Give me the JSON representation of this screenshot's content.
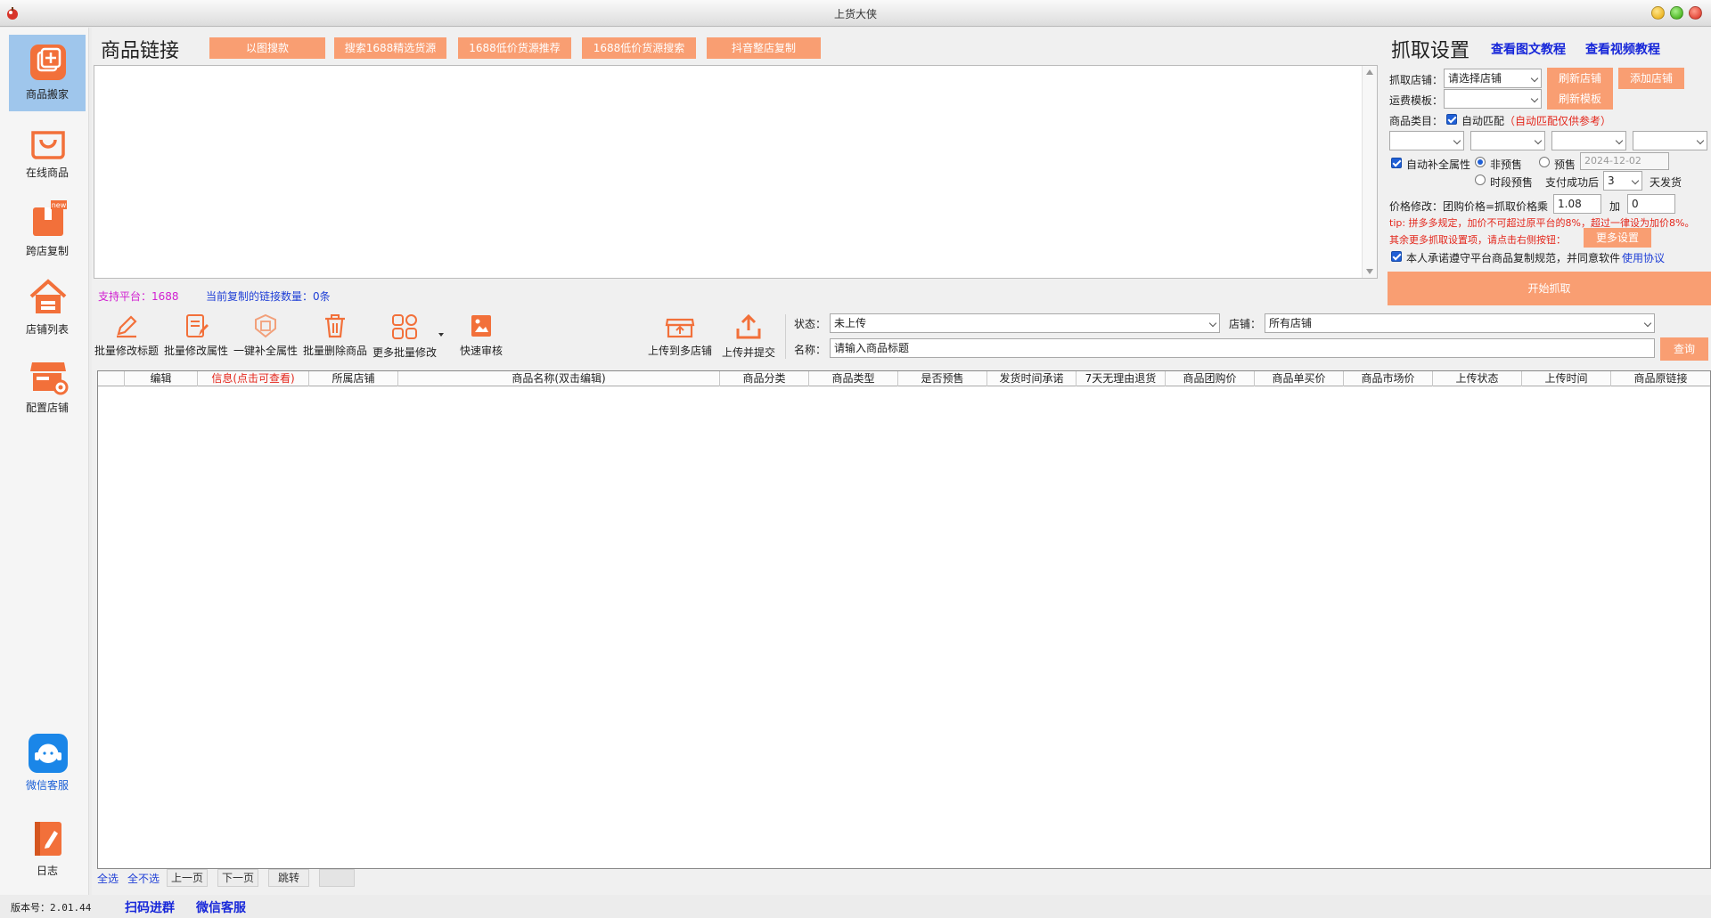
{
  "window": {
    "title": "上货大侠"
  },
  "sidebar": {
    "items": [
      {
        "label": "商品搬家"
      },
      {
        "label": "在线商品"
      },
      {
        "label": "跨店复制",
        "badge": "new"
      },
      {
        "label": "店铺列表"
      },
      {
        "label": "配置店铺"
      },
      {
        "label": "微信客服"
      },
      {
        "label": "日志"
      }
    ]
  },
  "links_section": {
    "title": "商品链接",
    "buttons": [
      "以图搜款",
      "搜索1688精选货源",
      "1688低价货源推荐",
      "1688低价货源搜索",
      "抖音整店复制"
    ],
    "support_platform": "支持平台：1688",
    "copied_count": "当前复制的链接数量：0条"
  },
  "toolbar": {
    "items": [
      "批量修改标题",
      "批量修改属性",
      "一键补全属性",
      "批量删除商品",
      "更多批量修改",
      "快速审核",
      "上传到多店铺",
      "上传并提交"
    ]
  },
  "filters": {
    "status_label": "状态：",
    "status_value": "未上传",
    "shop_label": "店铺：",
    "shop_value": "所有店铺",
    "name_label": "名称：",
    "name_placeholder": "请输入商品标题",
    "query_button": "查询"
  },
  "table": {
    "columns": [
      "编辑",
      "信息(点击可查看)",
      "所属店铺",
      "商品名称(双击编辑)",
      "商品分类",
      "商品类型",
      "是否预售",
      "发货时间承诺",
      "7天无理由退货",
      "商品团购价",
      "商品单买价",
      "商品市场价",
      "上传状态",
      "上传时间",
      "商品原链接"
    ]
  },
  "pager": {
    "select_all": "全选",
    "select_none": "全不选",
    "prev": "上一页",
    "next": "下一页",
    "jump": "跳转"
  },
  "settings": {
    "title": "抓取设置",
    "link_graphic": "查看图文教程",
    "link_video": "查看视频教程",
    "shop_label": "抓取店铺：",
    "shop_placeholder": "请选择店铺",
    "refresh_shop": "刷新店铺",
    "add_shop": "添加店铺",
    "freight_label": "运费模板：",
    "refresh_template": "刷新模板",
    "category_label": "商品类目：",
    "auto_match": "自动匹配",
    "auto_match_note": "（自动匹配仅供参考）",
    "auto_fill_attrs": "自动补全属性",
    "non_presale": "非预售",
    "presale": "预售",
    "presale_date": "2024-12-02",
    "period_presale": "时段预售",
    "pay_success_label": "支付成功后",
    "days_value": "3",
    "days_suffix": "天发货",
    "price_label": "价格修改：团购价格=抓取价格乘",
    "price_multiplier": "1.08",
    "price_add_label": "加",
    "price_add_value": "0",
    "tip": "tip: 拼多多规定，加价不可超过原平台的8%，超过一律设为加价8%。",
    "more_settings_text": "其余更多抓取设置项，请点击右侧按钮：",
    "more_settings_button": "更多设置",
    "agree_text": "本人承诺遵守平台商品复制规范，并同意软件",
    "agree_link": "使用协议",
    "start_button": "开始抓取"
  },
  "statusbar": {
    "version": "版本号：2.01.44",
    "qr_group": "扫码进群",
    "wechat_service": "微信客服"
  },
  "colors": {
    "accent_orange": "#f99e72",
    "link_blue": "#1727d9",
    "tip_red": "#e3261b",
    "support_magenta": "#d11fd1"
  }
}
